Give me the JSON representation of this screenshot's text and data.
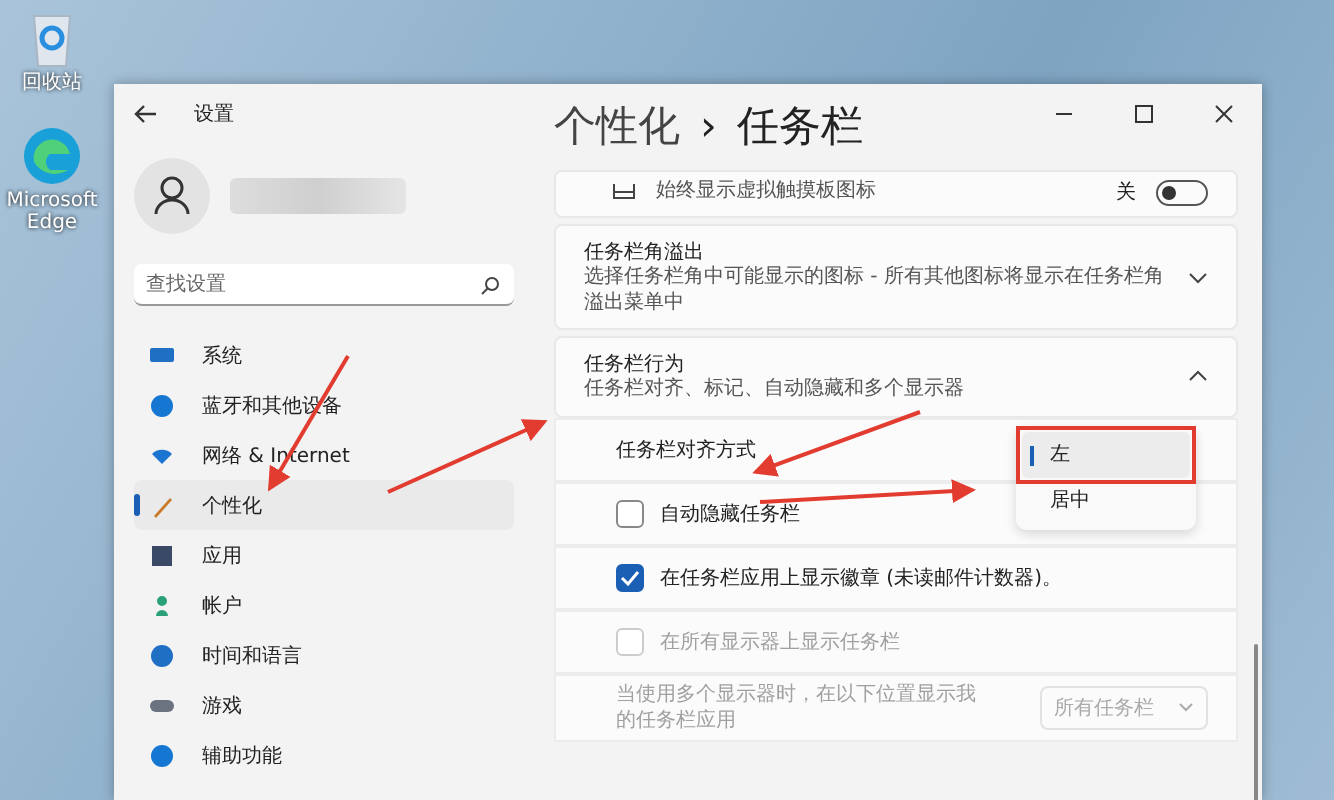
{
  "desktop_icons": [
    {
      "label": "回收站"
    },
    {
      "label": "Microsoft Edge"
    }
  ],
  "window": {
    "title": "设置"
  },
  "search": {
    "placeholder": "查找设置"
  },
  "sidebar": {
    "items": [
      {
        "label": "系统",
        "selected": false
      },
      {
        "label": "蓝牙和其他设备",
        "selected": false
      },
      {
        "label": "网络 & Internet",
        "selected": false
      },
      {
        "label": "个性化",
        "selected": true
      },
      {
        "label": "应用",
        "selected": false
      },
      {
        "label": "帐户",
        "selected": false
      },
      {
        "label": "时间和语言",
        "selected": false
      },
      {
        "label": "游戏",
        "selected": false
      },
      {
        "label": "辅助功能",
        "selected": false
      }
    ]
  },
  "breadcrumb": {
    "parent": "个性化",
    "separator": "›",
    "current": "任务栏"
  },
  "touchpad_card": {
    "subtitle": "始终显示虚拟触摸板图标",
    "toggle": {
      "label": "关",
      "on": false
    }
  },
  "overflow_card": {
    "title": "任务栏角溢出",
    "subtitle": "选择任务栏角中可能显示的图标 - 所有其他图标将显示在任务栏角溢出菜单中",
    "expanded": false
  },
  "behavior_card": {
    "title": "任务栏行为",
    "subtitle": "任务栏对齐、标记、自动隐藏和多个显示器",
    "expanded": true,
    "rows": [
      {
        "kind": "dropdown",
        "label": "任务栏对齐方式",
        "options": [
          {
            "label": "左",
            "selected": true
          },
          {
            "label": "居中",
            "selected": false
          }
        ]
      },
      {
        "kind": "checkbox",
        "label": "自动隐藏任务栏",
        "checked": false,
        "disabled": false
      },
      {
        "kind": "checkbox",
        "label": "在任务栏应用上显示徽章 (未读邮件计数器)。",
        "checked": true,
        "disabled": false
      },
      {
        "kind": "checkbox",
        "label": "在所有显示器上显示任务栏",
        "checked": false,
        "disabled": true
      },
      {
        "kind": "select",
        "label": "当使用多个显示器时，在以下位置显示我的任务栏应用",
        "value": "所有任务栏",
        "disabled": true
      }
    ]
  }
}
